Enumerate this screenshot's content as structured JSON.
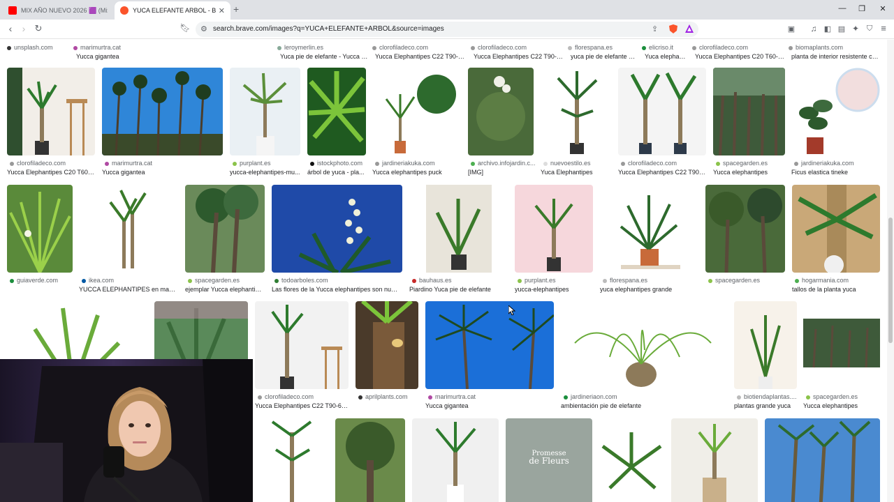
{
  "tabs": [
    {
      "label": "MIX AÑO NUEVO 2026 🟪 (Mix",
      "icon": "youtube-icon"
    },
    {
      "label": "YUCA ELEFANTE ARBOL - Brave",
      "icon": "brave-icon"
    }
  ],
  "address": {
    "url": "search.brave.com/images?q=YUCA+ELEFANTE+ARBOL&source=images"
  },
  "top_row": [
    {
      "source": "unsplash.com",
      "caption": ""
    },
    {
      "source": "marimurtra.cat",
      "caption": "Yucca gigantea"
    },
    {
      "source": "leroymerlin.es",
      "caption": "Yuca pie de elefante - Yucca el..."
    },
    {
      "source": "clorofiladeco.com",
      "caption": "Yucca Elephantipes C22 T90-6..."
    },
    {
      "source": "clorofiladeco.com",
      "caption": "Yucca Elephantipes C22 T90-6..."
    },
    {
      "source": "florespana.es",
      "caption": "yuca pie de elefante 8..."
    },
    {
      "source": "elicriso.it",
      "caption": "Yuca elephan..."
    },
    {
      "source": "clorofiladeco.com",
      "caption": "Yucca Elephantipes C20 T60-3..."
    },
    {
      "source": "biomaplants.com",
      "caption": "planta de interior resistente co..."
    }
  ],
  "row1": [
    {
      "source": "clorofiladeco.com",
      "caption": "Yucca Elephantipes C20 T60-..."
    },
    {
      "source": "marimurtra.cat",
      "caption": "Yucca gigantea"
    },
    {
      "source": "purplant.es",
      "caption": "yucca-elephantipes-mu..."
    },
    {
      "source": "istockphoto.com",
      "caption": "árbol de yuca - pla..."
    },
    {
      "source": "jardineriakuka.com",
      "caption": "Yucca elephantipes puck"
    },
    {
      "source": "archivo.infojardin.c...",
      "caption": "[IMG]"
    },
    {
      "source": "nuevoestilo.es",
      "caption": "Yuca Elephantipes"
    },
    {
      "source": "clorofiladeco.com",
      "caption": "Yucca Elephantipes C22 T90-..."
    },
    {
      "source": "spacegarden.es",
      "caption": "Yucca elephantipes"
    },
    {
      "source": "jardineriakuka.com",
      "caption": "Ficus elastica tineke"
    }
  ],
  "row2": [
    {
      "source": "guiaverde.com",
      "caption": ""
    },
    {
      "source": "ikea.com",
      "caption": "YUCCA ELEPHANTIPES en macet..."
    },
    {
      "source": "spacegarden.es",
      "caption": "ejemplar Yucca elephantipes"
    },
    {
      "source": "todoarboles.com",
      "caption": "Las flores de la Yucca elephantipes son numer..."
    },
    {
      "source": "bauhaus.es",
      "caption": "Piardino Yuca pie de elefante"
    },
    {
      "source": "purplant.es",
      "caption": "yucca-elephantipes"
    },
    {
      "source": "florespana.es",
      "caption": "yuca elephantipes grande"
    },
    {
      "source": "spacegarden.es",
      "caption": ""
    },
    {
      "source": "hogarmania.com",
      "caption": "tallos de la planta yuca"
    }
  ],
  "row3": [
    {
      "source": "clorofiladeco.com",
      "caption": "Yucca Elephantipes C22 T90-60..."
    },
    {
      "source": "aprilplants.com",
      "caption": ""
    },
    {
      "source": "marimurtra.cat",
      "caption": "Yucca gigantea"
    },
    {
      "source": "jardineriaon.com",
      "caption": "ambientación pie de elefante"
    },
    {
      "source": "biotiendaplantas....",
      "caption": "plantas grande yuca"
    },
    {
      "source": "spacegarden.es",
      "caption": "Yucca elephantipes"
    }
  ],
  "row4_promo": {
    "line1": "Promesse",
    "line2": "de Fleurs"
  },
  "colors": {
    "accent": "#1a73e8",
    "tabbar": "#dfe1e5",
    "brave": "#fb542b"
  }
}
